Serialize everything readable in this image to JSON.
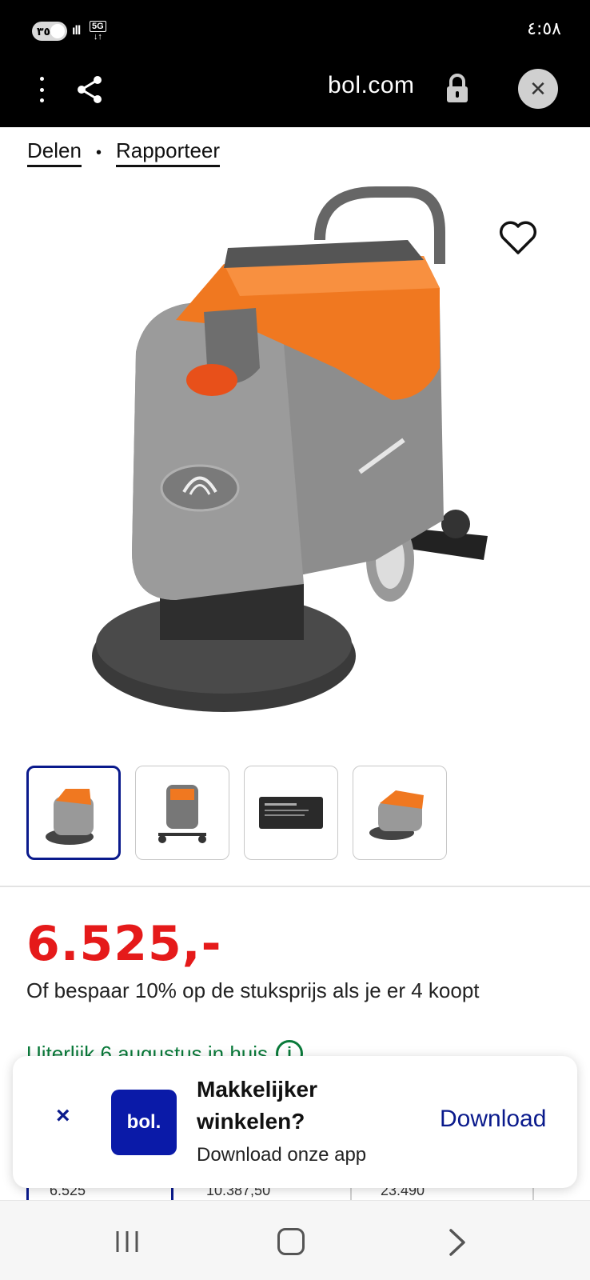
{
  "status_bar": {
    "pill_text": "٣٥",
    "signal_text": "ıll",
    "network_label": "5G",
    "time": "٤:٥٨"
  },
  "browser": {
    "url": "bol.com",
    "icons": [
      "more-vert-icon",
      "share-icon",
      "lock-icon",
      "close-icon"
    ]
  },
  "links": {
    "share": "Delen",
    "separator": "•",
    "report": "Rapporteer"
  },
  "product": {
    "thumbnails_count": 4,
    "active_thumbnail": 1,
    "price": "6.525,-",
    "offer": "Of bespaar 10% op de stuksprijs als je er 4 koopt",
    "delivery": "Uiterlijk 6 augustus in huis",
    "colors": {
      "price": "#e51a1a",
      "delivery": "#0a7a3a",
      "brand": "#0a1aa8"
    }
  },
  "table_fragment": {
    "cells": [
      "6.525",
      "10.387,50",
      "23.490"
    ]
  },
  "app_banner": {
    "close_label": "×",
    "logo_text": "bol.",
    "title": "Makkelijker winkelen?",
    "subtitle": "Download onze app",
    "download_label": "Download"
  }
}
